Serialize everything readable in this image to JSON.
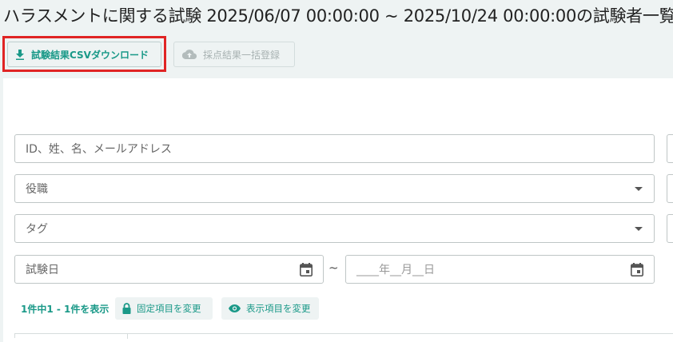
{
  "page": {
    "title": "ハラスメントに関する試験 2025/06/07 00:00:00 ~ 2025/10/24 00:00:00の試験者一覧"
  },
  "toolbar": {
    "csv_download_label": "試験結果CSVダウンロード",
    "bulk_register_label": "採点結果一括登録"
  },
  "filters": {
    "search_placeholder": "ID、姓、名、メールアドレス",
    "position_label": "役職",
    "tag_label": "タグ",
    "exam_date_label": "試験日",
    "date_separator": "~",
    "date_end_placeholder": "____年__月__日"
  },
  "results": {
    "count_text": "1件中1 - 1件を表示",
    "fixed_items_label": "固定項目を変更",
    "display_items_label": "表示項目を変更"
  },
  "colors": {
    "accent": "#1a9988",
    "highlight_border": "#e02424"
  },
  "icons": {
    "download": "download-icon",
    "cloud_upload": "cloud-upload-icon",
    "calendar": "calendar-icon",
    "lock": "lock-icon",
    "eye": "eye-icon",
    "dropdown": "chevron-down-icon"
  }
}
